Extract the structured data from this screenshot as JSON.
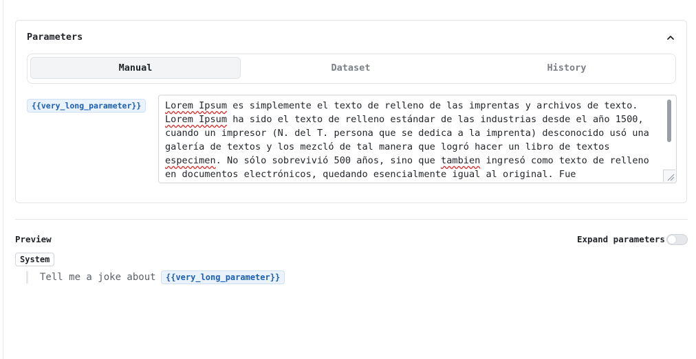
{
  "parameters": {
    "title": "Parameters",
    "tabs": [
      "Manual",
      "Dataset",
      "History"
    ],
    "active_tab": "Manual",
    "param_name": "{{very_long_parameter}}",
    "param_value_parts": [
      {
        "t": "Lorem Ipsum",
        "spell": true
      },
      {
        "t": " es simplemente el texto de relleno de las imprentas y archivos de texto. ",
        "spell": false
      },
      {
        "t": "Lorem Ipsum",
        "spell": true
      },
      {
        "t": " ha sido el texto de relleno estándar de las industrias desde el año 1500, cuando un impresor (N. del T. persona que se dedica a la imprenta) desconocido usó una galería de textos y los mezcló de tal manera que logró hacer un libro de textos ",
        "spell": false
      },
      {
        "t": "especimen",
        "spell": true
      },
      {
        "t": ". No sólo sobrevivió 500 años, sino que ",
        "spell": false
      },
      {
        "t": "tambien",
        "spell": true
      },
      {
        "t": " ingresó como texto de relleno en documentos electrónicos, quedando esencialmente igual al original. Fue",
        "spell": false
      }
    ]
  },
  "preview": {
    "title": "Preview",
    "expand_label": "Expand parameters",
    "expand_on": false,
    "role_badge": "System",
    "message_text": "Tell me a joke about",
    "message_param": "{{very_long_parameter}}"
  },
  "colors": {
    "chip_bg": "#eaf2fc",
    "chip_text": "#1a5fb4",
    "border": "#e3e5e8"
  },
  "icons": {
    "collapse": "chevron-up-icon"
  }
}
